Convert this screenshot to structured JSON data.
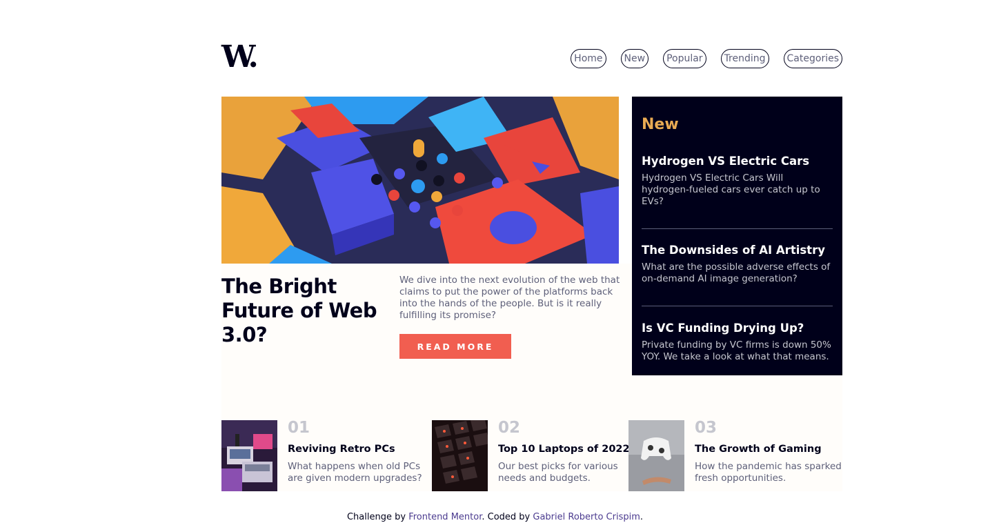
{
  "header": {
    "logo": "W.",
    "nav": [
      "Home",
      "New",
      "Popular",
      "Trending",
      "Categories"
    ]
  },
  "hero": {
    "title": "The Bright Future of Web 3.0?",
    "text": "We dive into the next evolution of the web that claims to put the power of the platforms back into the hands of the people. But is it really fulfilling its promise?",
    "button": "READ MORE"
  },
  "new_panel": {
    "heading": "New",
    "items": [
      {
        "title": "Hydrogen VS Electric Cars",
        "desc": "Hydrogen VS Electric Cars Will hydrogen-fueled cars ever catch up to EVs?"
      },
      {
        "title": "The Downsides of AI Artistry",
        "desc": "What are the possible adverse effects of on-demand AI image generation?"
      },
      {
        "title": "Is VC Funding Drying Up?",
        "desc": "Private funding by VC firms is down 50% YOY. We take a look at what that means."
      }
    ]
  },
  "articles": [
    {
      "num": "01",
      "title": "Reviving Retro PCs",
      "desc": "What happens when old PCs are given modern upgrades?"
    },
    {
      "num": "02",
      "title": "Top 10 Laptops of 2022",
      "desc": "Our best picks for various needs and budgets."
    },
    {
      "num": "03",
      "title": "The Growth of Gaming",
      "desc": "How the pandemic has sparked fresh opportunities."
    }
  ],
  "footer": {
    "prefix": "Challenge by ",
    "link1": "Frontend Mentor",
    "middle": ". Coded by ",
    "link2": "Gabriel Roberto Crispim",
    "suffix": "."
  },
  "colors": {
    "accent": "#f15e50",
    "panel": "#00001a",
    "new_heading": "#e9ab53"
  }
}
